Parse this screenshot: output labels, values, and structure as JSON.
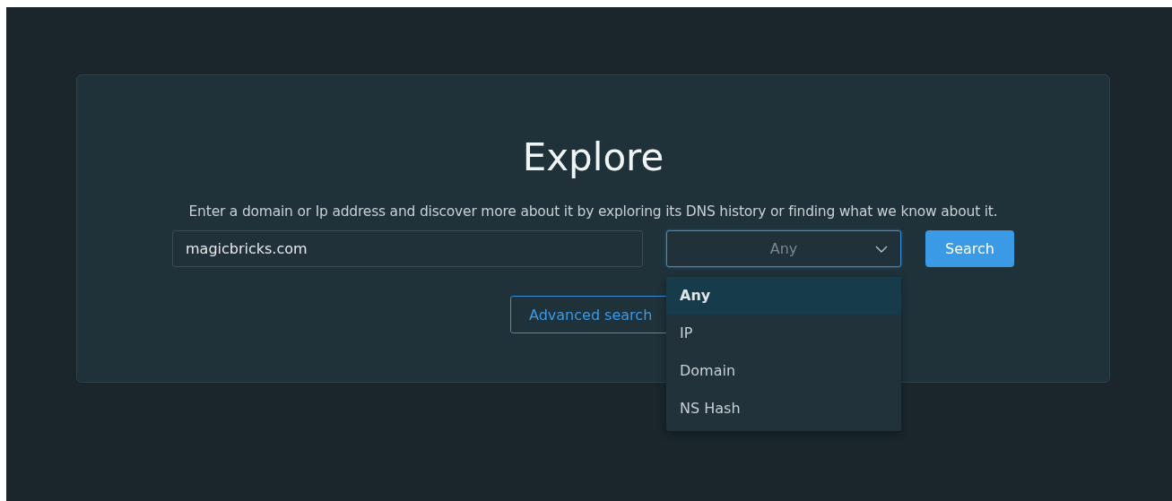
{
  "title": "Explore",
  "description": "Enter a domain or Ip address and discover more about it by exploring its DNS history or finding what we know about it.",
  "search_field": {
    "value": "magicbricks.com"
  },
  "type_select": {
    "value": "Any",
    "expanded": true,
    "options": [
      {
        "label": "Any",
        "selected": true
      },
      {
        "label": "IP",
        "selected": false
      },
      {
        "label": "Domain",
        "selected": false
      },
      {
        "label": "NS Hash",
        "selected": false
      }
    ]
  },
  "search_button": "Search",
  "advanced_search_button": "Advanced search"
}
